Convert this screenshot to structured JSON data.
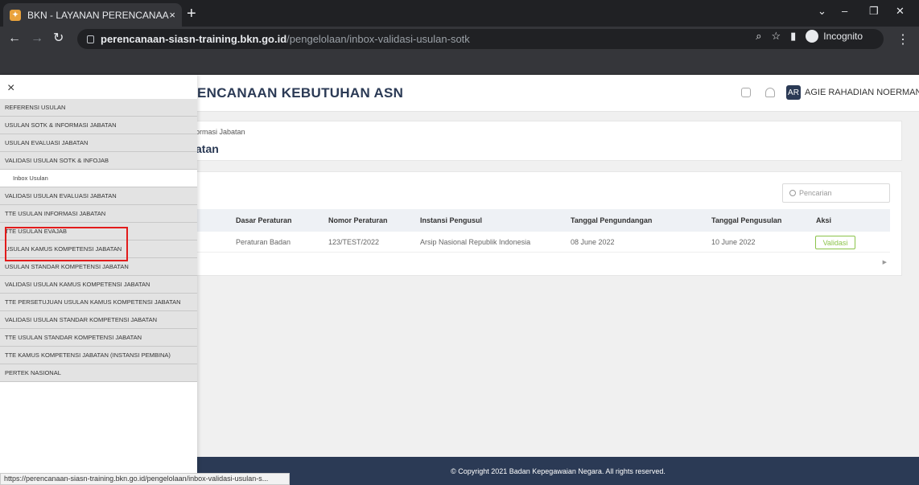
{
  "browser": {
    "tab_title": "BKN - LAYANAN PERENCANAAN",
    "tab_close": "×",
    "new_tab": "+",
    "url_domain": "perencanaan-siasn-training.bkn.go.id",
    "url_path": "/pengelolaan/inbox-validasi-usulan-sotk",
    "incognito_label": "Incognito",
    "status_url": "https://perencanaan-siasn-training.bkn.go.id/pengelolaan/inbox-validasi-usulan-s..."
  },
  "header": {
    "title": "ENCANAAN KEBUTUHAN ASN",
    "avatar_initials": "AR",
    "user_name": "AGIE RAHADIAN NOERMAN ⌄"
  },
  "breadcrumb": {
    "path": "ormasi Jabatan",
    "title": "atan"
  },
  "table": {
    "search_placeholder": "Pencarian",
    "columns": [
      "Dasar Peraturan",
      "Nomor Peraturan",
      "Instansi Pengusul",
      "Tanggal Pengundangan",
      "Tanggal Pengusulan",
      "Aksi"
    ],
    "rows": [
      {
        "dasar": "Peraturan Badan",
        "nomor": "123/TEST/2022",
        "instansi": "Arsip Nasional Republik Indonesia",
        "tgl_pengundangan": "08 June 2022",
        "tgl_pengusulan": "10 June 2022",
        "aksi": "Validasi"
      }
    ]
  },
  "footer": {
    "text": "© Copyright 2021 Badan Kepegawaian Negara. All rights reserved."
  },
  "sidebar": {
    "close": "×",
    "items": [
      {
        "label": "REFERENSI USULAN"
      },
      {
        "label": "USULAN SOTK & INFORMASI JABATAN"
      },
      {
        "label": "USULAN EVALUASI JABATAN"
      },
      {
        "label": "VALIDASI USULAN SOTK & INFOJAB"
      },
      {
        "label": "Inbox Usulan"
      },
      {
        "label": "VALIDASI USULAN EVALUASI JABATAN"
      },
      {
        "label": "TTE USULAN INFORMASI JABATAN"
      },
      {
        "label": "TTE USULAN EVAJAB"
      },
      {
        "label": "USULAN KAMUS KOMPETENSI JABATAN"
      },
      {
        "label": "USULAN STANDAR KOMPETENSI JABATAN"
      },
      {
        "label": "VALIDASI USULAN KAMUS KOMPETENSI JABATAN"
      },
      {
        "label": "TTE PERSETUJUAN USULAN KAMUS KOMPETENSI JABATAN"
      },
      {
        "label": "VALIDASI USULAN STANDAR KOMPETENSI JABATAN"
      },
      {
        "label": "TTE USULAN STANDAR KOMPETENSI JABATAN"
      },
      {
        "label": "TTE KAMUS KOMPETENSI JABATAN (INSTANSI PEMBINA)"
      },
      {
        "label": "PERTEK NASIONAL"
      }
    ]
  },
  "colors": {
    "brand_navy": "#2b3a55",
    "validasi_green": "#8bc34a",
    "highlight_red": "#e21b1b"
  }
}
